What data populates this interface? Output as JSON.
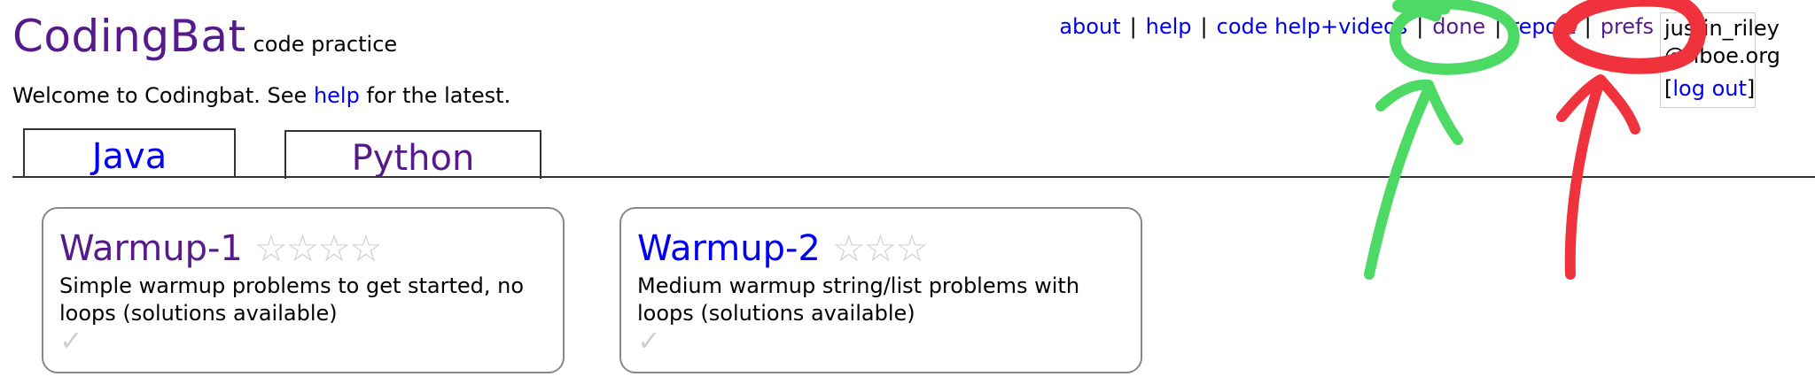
{
  "brand": {
    "name": "CodingBat",
    "subtitle": "code practice"
  },
  "welcome": {
    "before": "Welcome to Codingbat. See ",
    "link": "help",
    "after": " for the latest."
  },
  "topnav": {
    "about": "about",
    "help": "help",
    "code_help_videos": "code help+videos",
    "done": "done",
    "report": "report",
    "prefs": "prefs",
    "separator": "|"
  },
  "user": {
    "line1": "justin_riley",
    "line2": "@nboe.org",
    "logout_open": "[",
    "logout_label": "log out",
    "logout_close": "]"
  },
  "tabs": [
    {
      "label": "Java"
    },
    {
      "label": "Python"
    }
  ],
  "cards": [
    {
      "title": "Warmup-1",
      "stars": "☆☆☆☆",
      "description": "Simple warmup problems to get started, no loops (solutions available)",
      "check": "✓"
    },
    {
      "title": "Warmup-2",
      "stars": "☆☆☆",
      "description": "Medium warmup string/list problems with loops (solutions available)",
      "check": "✓"
    }
  ],
  "colors": {
    "link": "#0000ee",
    "visited": "#551a8b",
    "annotation_green": "#4cd964",
    "annotation_red": "#f0323c"
  }
}
